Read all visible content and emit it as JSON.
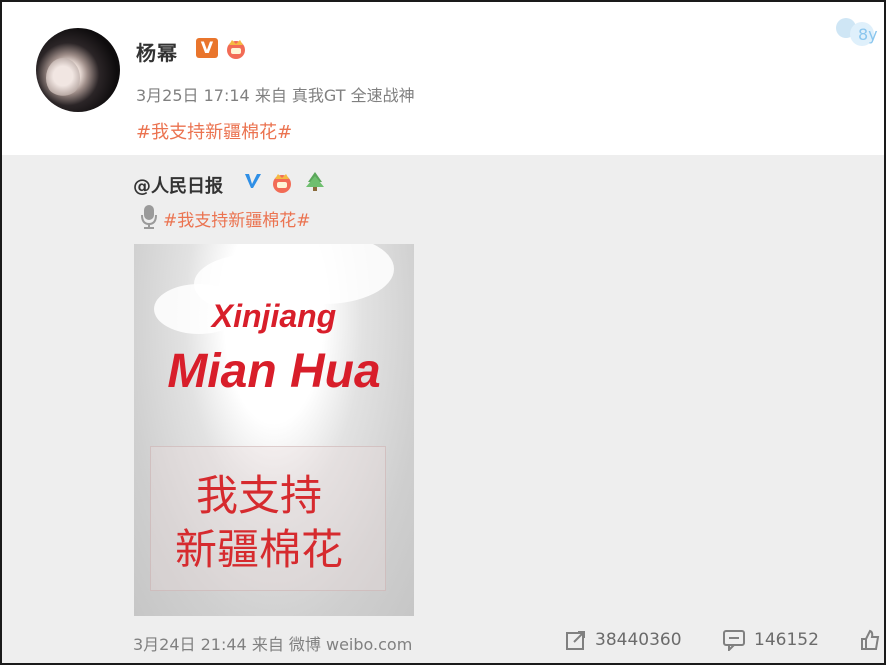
{
  "post": {
    "author": "杨幂",
    "verified_badge": "V",
    "meta": "3月25日 17:14 来自 真我GT 全速战神",
    "topic": "#我支持新疆棉花#"
  },
  "repost": {
    "author": "@人民日报",
    "topic": "#我支持新疆棉花#",
    "image": {
      "line1": "Xinjiang",
      "line2": "Mian Hua",
      "zh_line1": "我支持",
      "zh_line2": "新疆棉花"
    },
    "footer_meta": "3月24日 21:44 来自 微博 weibo.com",
    "repost_count": "38440360",
    "comment_count": "146152"
  },
  "colors": {
    "topic": "#eb7350",
    "poster_red": "#d81e2a",
    "verified_orange": "#e9752c",
    "verified_blue": "#2f8fe6"
  },
  "icons": [
    "crown-icon",
    "verified-blue-icon",
    "tree-icon",
    "microphone-icon",
    "repost-icon",
    "comment-icon",
    "like-icon"
  ]
}
